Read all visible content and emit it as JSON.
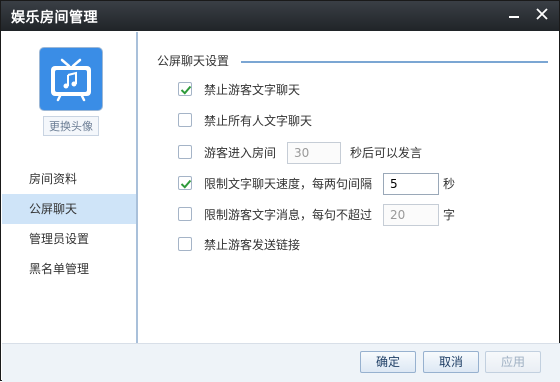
{
  "window": {
    "title": "娱乐房间管理"
  },
  "sidebar": {
    "change_avatar_label": "更换头像",
    "items": [
      {
        "label": "房间资料",
        "active": false
      },
      {
        "label": "公屏聊天",
        "active": true
      },
      {
        "label": "管理员设置",
        "active": false
      },
      {
        "label": "黑名单管理",
        "active": false
      }
    ]
  },
  "section": {
    "title": "公屏聊天设置"
  },
  "options": {
    "ban_guest_text": {
      "label": "禁止游客文字聊天",
      "checked": true
    },
    "ban_all_text": {
      "label": "禁止所有人文字聊天",
      "checked": false
    },
    "guest_delay": {
      "label": "游客进入房间",
      "value": "30",
      "suffix": "秒后可以发言",
      "checked": false
    },
    "limit_speed": {
      "label": "限制文字聊天速度，每两句间隔",
      "value": "5",
      "suffix": "秒",
      "checked": true
    },
    "limit_length": {
      "label": "限制游客文字消息，每句不超过",
      "value": "20",
      "suffix": "字",
      "checked": false
    },
    "ban_links": {
      "label": "禁止游客发送链接",
      "checked": false
    }
  },
  "footer": {
    "ok_label": "确定",
    "cancel_label": "取消",
    "apply_label": "应用"
  },
  "colors": {
    "titlebar": "#2b3036",
    "accent": "#3a8de6",
    "active_nav": "#cfe4f8",
    "check": "#2e9a3a"
  }
}
